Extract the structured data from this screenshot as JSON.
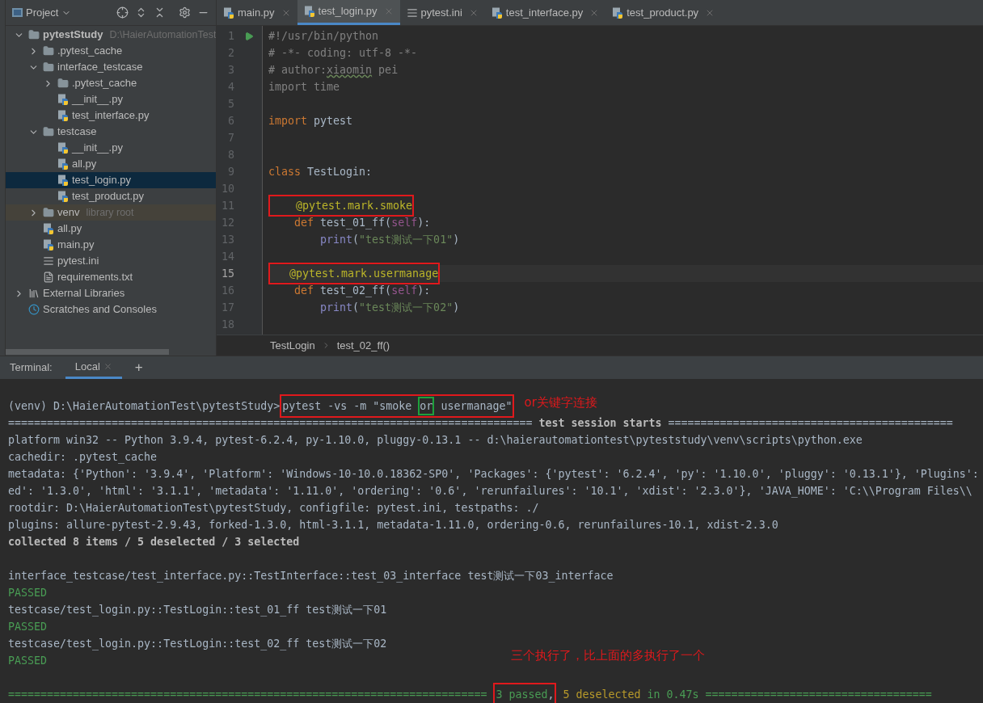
{
  "project_panel": {
    "title": "Project",
    "tree": [
      {
        "label": "pytestStudy",
        "hint": "D:\\HaierAutomationTest",
        "kind": "folder",
        "expanded": true,
        "selected": false,
        "bold": true,
        "children": [
          {
            "label": ".pytest_cache",
            "kind": "folder",
            "expanded": false,
            "selected": false
          },
          {
            "label": "interface_testcase",
            "kind": "package",
            "expanded": true,
            "selected": false,
            "children": [
              {
                "label": ".pytest_cache",
                "kind": "folder",
                "expanded": false,
                "selected": false
              },
              {
                "label": "__init__.py",
                "kind": "python",
                "selected": false
              },
              {
                "label": "test_interface.py",
                "kind": "python",
                "selected": false
              }
            ]
          },
          {
            "label": "testcase",
            "kind": "package",
            "expanded": true,
            "selected": false,
            "children": [
              {
                "label": "__init__.py",
                "kind": "python",
                "selected": false
              },
              {
                "label": "all.py",
                "kind": "python",
                "selected": false
              },
              {
                "label": "test_login.py",
                "kind": "python",
                "selected": true
              },
              {
                "label": "test_product.py",
                "kind": "python",
                "selected": false
              }
            ]
          },
          {
            "label": "venv",
            "hint": "library root",
            "kind": "library-folder",
            "expanded": false,
            "selected": false
          },
          {
            "label": "all.py",
            "kind": "python",
            "selected": false
          },
          {
            "label": "main.py",
            "kind": "python",
            "selected": false
          },
          {
            "label": "pytest.ini",
            "kind": "ini",
            "selected": false
          },
          {
            "label": "requirements.txt",
            "kind": "text",
            "selected": false
          }
        ]
      },
      {
        "label": "External Libraries",
        "kind": "libraries",
        "expanded": false,
        "selected": false
      },
      {
        "label": "Scratches and Consoles",
        "kind": "scratches",
        "selected": false
      }
    ]
  },
  "editor": {
    "tabs": [
      {
        "label": "main.py",
        "kind": "python",
        "selected": false
      },
      {
        "label": "test_login.py",
        "kind": "python",
        "selected": true
      },
      {
        "label": "pytest.ini",
        "kind": "ini",
        "selected": false
      },
      {
        "label": "test_interface.py",
        "kind": "python",
        "selected": false
      },
      {
        "label": "test_product.py",
        "kind": "python",
        "selected": false
      }
    ],
    "lines": [
      {
        "n": "1",
        "run": true,
        "current": false,
        "tokens": [
          {
            "t": "#!/usr/bin/python",
            "kind": "comment"
          }
        ]
      },
      {
        "n": "2",
        "run": false,
        "current": false,
        "tokens": [
          {
            "t": "# -*- coding: utf-8 -*-",
            "kind": "comment"
          }
        ]
      },
      {
        "n": "3",
        "run": false,
        "current": false,
        "tokens": [
          {
            "t": "# author:",
            "kind": "comment"
          },
          {
            "t": "xiaomin",
            "kind": "typo"
          },
          {
            "t": " pei",
            "kind": "comment"
          }
        ]
      },
      {
        "n": "4",
        "run": false,
        "current": false,
        "tokens": [
          {
            "t": "import time",
            "kind": "comment"
          }
        ]
      },
      {
        "n": "5",
        "run": false,
        "current": false
      },
      {
        "n": "6",
        "run": false,
        "current": false,
        "tokens": [
          {
            "t": "import",
            "kind": "keyword"
          },
          {
            "t": " pytest",
            "kind": "plain"
          }
        ]
      },
      {
        "n": "7",
        "run": false,
        "current": false
      },
      {
        "n": "8",
        "run": false,
        "current": false
      },
      {
        "n": "9",
        "run": false,
        "current": false,
        "tokens": [
          {
            "t": "class",
            "kind": "keyword"
          },
          {
            "t": " TestLogin:",
            "kind": "plain"
          }
        ]
      },
      {
        "n": "10",
        "run": false,
        "current": false
      },
      {
        "n": "11",
        "run": false,
        "current": false,
        "tokens": [
          {
            "t": "    @pytest.mark.smoke",
            "kind": "decorator",
            "color": "#e0191c"
          }
        ]
      },
      {
        "n": "12",
        "run": false,
        "current": false,
        "tokens": [
          {
            "t": "    def",
            "kind": "keyword"
          },
          {
            "t": " test_01_ff(",
            "kind": "plain"
          },
          {
            "t": "self",
            "kind": "self"
          },
          {
            "t": "):",
            "kind": "plain"
          }
        ]
      },
      {
        "n": "13",
        "run": false,
        "current": false,
        "tokens": [
          {
            "t": "        print",
            "kind": "builtin"
          },
          {
            "t": "(",
            "kind": "plain"
          },
          {
            "t": "\"test测试一下01\"",
            "kind": "string"
          },
          {
            "t": ")",
            "kind": "plain"
          }
        ]
      },
      {
        "n": "14",
        "run": false,
        "current": false
      },
      {
        "n": "15",
        "run": false,
        "current": true,
        "tokens": [
          {
            "t": "   @pytest.mark.usermanage",
            "kind": "decorator",
            "color": "#e0191c"
          }
        ]
      },
      {
        "n": "16",
        "run": false,
        "current": false,
        "tokens": [
          {
            "t": "    def",
            "kind": "keyword"
          },
          {
            "t": " test_02_ff(",
            "kind": "plain"
          },
          {
            "t": "self",
            "kind": "self"
          },
          {
            "t": "):",
            "kind": "plain"
          }
        ]
      },
      {
        "n": "17",
        "run": false,
        "current": false,
        "tokens": [
          {
            "t": "        print",
            "kind": "builtin"
          },
          {
            "t": "(",
            "kind": "plain"
          },
          {
            "t": "\"test测试一下02\"",
            "kind": "string"
          },
          {
            "t": ")",
            "kind": "plain"
          }
        ]
      },
      {
        "n": "18",
        "run": false,
        "current": false
      }
    ],
    "breadcrumbs": [
      "TestLogin",
      "test_02_ff()"
    ]
  },
  "terminal": {
    "label": "Terminal:",
    "tabs": [
      {
        "label": "Local",
        "selected": true
      }
    ],
    "add": "+",
    "blocks": [
      {
        "lines": [
          {
            "segments": [
              {
                "t": "(venv) D:\\HaierAutomationTest\\pytestStudy>",
                "kind": "plain"
              },
              {
                "kind": "group",
                "color": "#e0191c",
                "parts": [
                  {
                    "t": "pytest -vs -m \"smoke ",
                    "kind": "plain"
                  },
                  {
                    "t": "or",
                    "kind": "plain",
                    "color": "#1ea03c"
                  },
                  {
                    "t": " usermanage\"",
                    "kind": "plain"
                  }
                ]
              }
            ],
            "note": "or关键字连接"
          },
          {
            "segments": [
              {
                "t": "================================================================================= ",
                "kind": "plain"
              },
              {
                "t": "test session starts",
                "kind": "bold"
              },
              {
                "t": " ============================================",
                "kind": "plain"
              }
            ]
          },
          {
            "segments": [
              {
                "t": "platform win32 -- Python 3.9.4, pytest-6.2.4, py-1.10.0, pluggy-0.13.1 -- d:\\haierautomationtest\\pyteststudy\\venv\\scripts\\python.exe",
                "kind": "plain"
              }
            ]
          },
          {
            "segments": [
              {
                "t": "cachedir: .pytest_cache",
                "kind": "plain"
              }
            ]
          },
          {
            "segments": [
              {
                "t": "metadata: {'Python': '3.9.4', 'Platform': 'Windows-10-10.0.18362-SP0', 'Packages': {'pytest': '6.2.4', 'py': '1.10.0', 'pluggy': '0.13.1'}, 'Plugins':",
                "kind": "plain"
              }
            ]
          },
          {
            "segments": [
              {
                "t": "ed': '1.3.0', 'html': '3.1.1', 'metadata': '1.11.0', 'ordering': '0.6', 'rerunfailures': '10.1', 'xdist': '2.3.0'}, 'JAVA_HOME': 'C:\\\\Program Files\\\\",
                "kind": "plain"
              }
            ]
          },
          {
            "segments": [
              {
                "t": "rootdir: D:\\HaierAutomationTest\\pytestStudy, configfile: pytest.ini, testpaths: ./",
                "kind": "plain"
              }
            ]
          },
          {
            "segments": [
              {
                "t": "plugins: allure-pytest-2.9.43, forked-1.3.0, html-3.1.1, metadata-1.11.0, ordering-0.6, rerunfailures-10.1, xdist-2.3.0",
                "kind": "plain"
              }
            ]
          },
          {
            "segments": [
              {
                "t": "collected 8 items / 5 deselected / 3 selected",
                "kind": "bold"
              }
            ]
          }
        ]
      },
      {
        "lines": [
          {
            "segments": [
              {
                "t": "interface_testcase/test_interface.py::TestInterface::test_03_interface test测试一下03_interface",
                "kind": "plain"
              }
            ]
          },
          {
            "segments": [
              {
                "t": "PASSED",
                "kind": "pass"
              }
            ]
          },
          {
            "segments": [
              {
                "t": "testcase/test_login.py::TestLogin::test_01_ff test测试一下01",
                "kind": "plain"
              }
            ]
          },
          {
            "segments": [
              {
                "t": "PASSED",
                "kind": "pass"
              }
            ]
          },
          {
            "segments": [
              {
                "t": "testcase/test_login.py::TestLogin::test_02_ff test测试一下02",
                "kind": "plain"
              }
            ]
          },
          {
            "segments": [
              {
                "t": "PASSED",
                "kind": "pass"
              }
            ],
            "note": "三个执行了，比上面的多执行了一个"
          }
        ]
      },
      {
        "lines": [
          {
            "segments": [
              {
                "t": "========================================================================== ",
                "kind": "pass"
              },
              {
                "kind": "group",
                "color": "#e0191c",
                "parts": [
                  {
                    "t": "3 passed",
                    "kind": "pass"
                  },
                  {
                    "t": ",",
                    "kind": "plain"
                  }
                ]
              },
              {
                "t": " 5 deselected",
                "kind": "warn"
              },
              {
                "t": " in 0.47s ===================================",
                "kind": "pass"
              }
            ]
          }
        ]
      }
    ]
  }
}
